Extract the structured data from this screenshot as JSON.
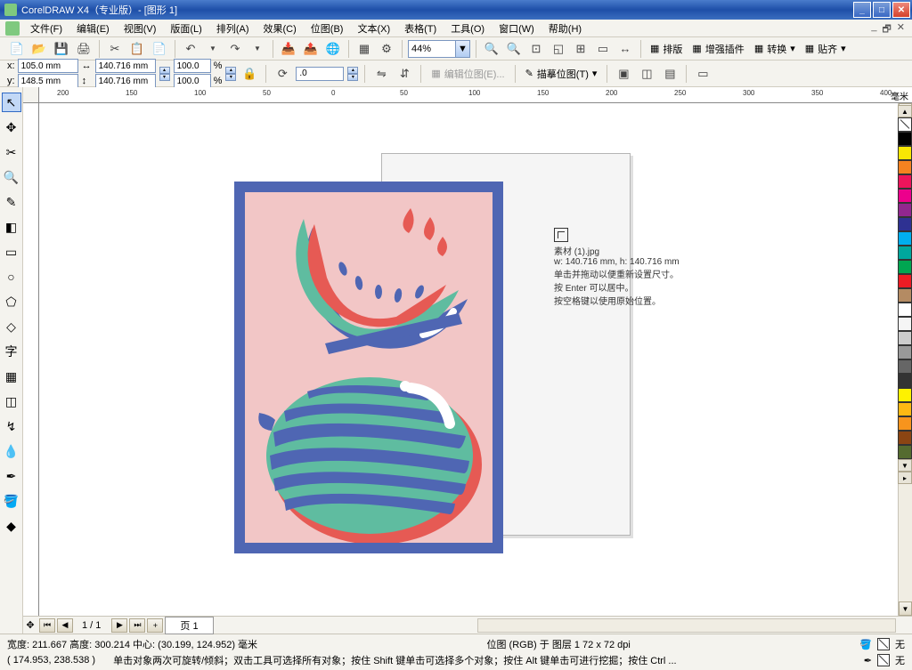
{
  "title": "CorelDRAW X4（专业版）- [图形 1]",
  "menu": [
    "文件(F)",
    "编辑(E)",
    "视图(V)",
    "版面(L)",
    "排列(A)",
    "效果(C)",
    "位图(B)",
    "文本(X)",
    "表格(T)",
    "工具(O)",
    "窗口(W)",
    "帮助(H)"
  ],
  "zoom": "44%",
  "toolbar_right": {
    "layout": "排版",
    "enhance": "增强插件",
    "convert": "转换",
    "align": "贴齐"
  },
  "props": {
    "x": "105.0 mm",
    "y": "148.5 mm",
    "w": "140.716 mm",
    "h": "140.716 mm",
    "sx": "100.0",
    "sy": "100.0",
    "pct": "%",
    "rot": ".0",
    "edit_bitmap": "编辑位图(E)...",
    "trace_bitmap": "描摹位图(T)"
  },
  "ruler_unit": "毫米",
  "ruler_h": [
    200,
    150,
    100,
    50,
    0,
    50,
    100,
    150,
    200,
    250,
    300,
    350,
    400
  ],
  "info": {
    "filename": "素材 (1).jpg",
    "size": "w: 140.716 mm, h: 140.716 mm",
    "l1": "单击并拖动以便重新设置尺寸。",
    "l2": "按 Enter 可以居中。",
    "l3": "按空格键以使用原始位置。"
  },
  "pager": {
    "pages": "1 / 1",
    "tab": "页 1"
  },
  "status": {
    "dims": "宽度: 211.667 高度: 300.214 中心: (30.199, 124.952) 毫米",
    "bitmap": "位图 (RGB) 于 图层 1 72 x 72 dpi",
    "none1": "无",
    "coords": "( 174.953, 238.538 )",
    "hint": "单击对象两次可旋转/倾斜；双击工具可选择所有对象；按住 Shift 键单击可选择多个对象；按住 Alt 键单击可进行挖掘；按住 Ctrl ...",
    "none2": "无"
  },
  "palette": [
    "#000000",
    "#f8e704",
    "#f58220",
    "#ed145b",
    "#ec008c",
    "#92278f",
    "#2e3192",
    "#00aeef",
    "#00a79d",
    "#00a651",
    "#ed1c24",
    "#b48b63",
    "#ffffff",
    "#f5f5f5",
    "#cccccc",
    "#999999",
    "#666666",
    "#333333",
    "#fef200",
    "#fdb913",
    "#f7941d",
    "#8b4513",
    "#556b2f"
  ]
}
